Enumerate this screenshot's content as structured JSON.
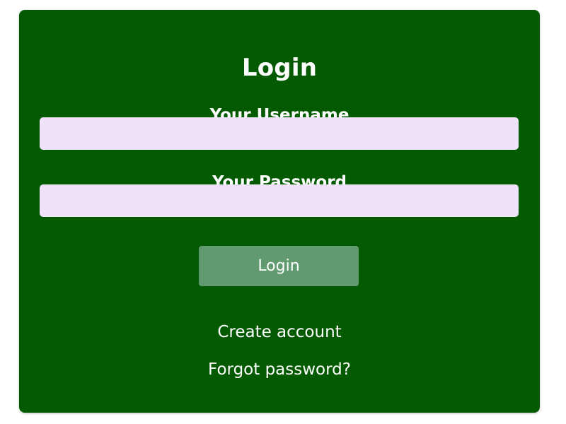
{
  "form": {
    "title": "Login",
    "username_label": "Your Username",
    "username_value": "",
    "password_label": "Your Password",
    "password_value": "",
    "submit_label": "Login",
    "create_account_label": "Create account",
    "forgot_password_label": "Forgot password?"
  },
  "colors": {
    "card_background": "#035a00",
    "input_background": "#f0e2fa",
    "button_background": "#629a6f",
    "text": "#ffffff"
  }
}
